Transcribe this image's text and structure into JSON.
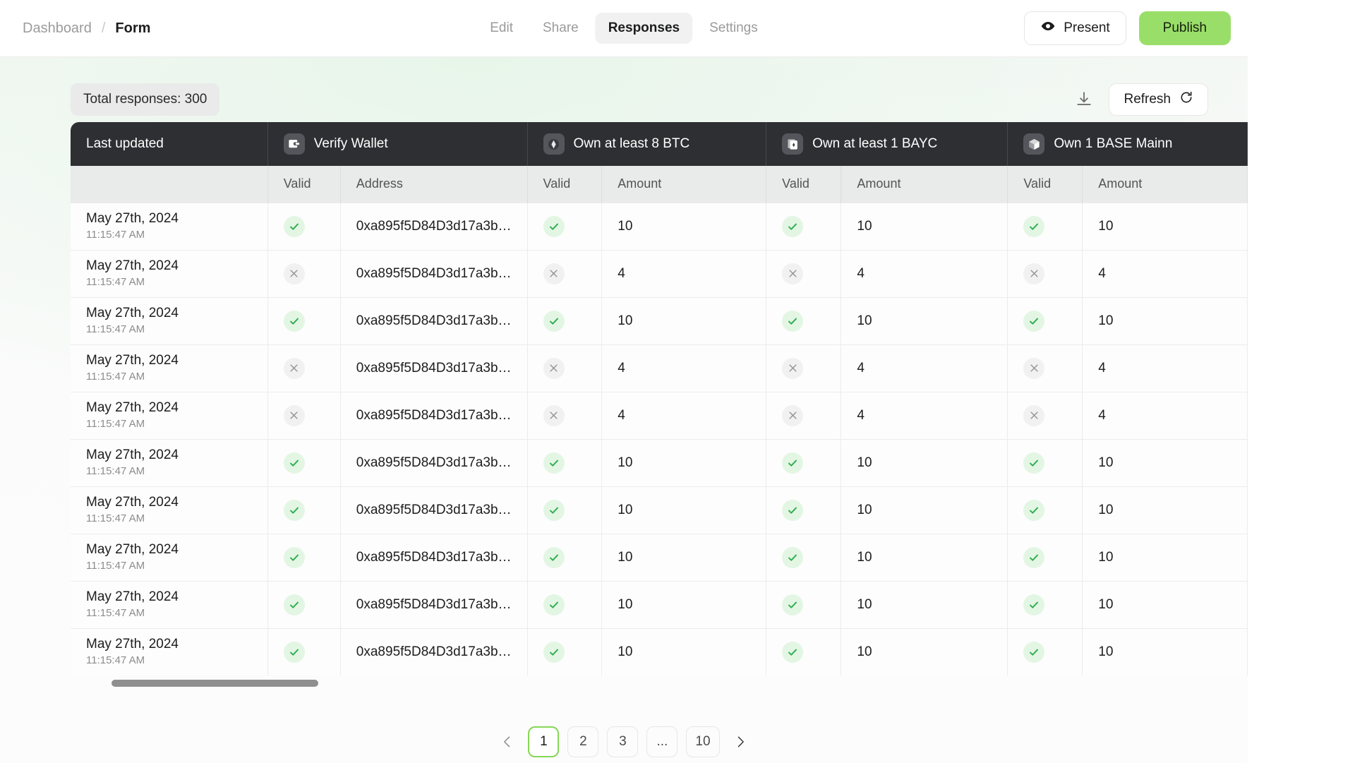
{
  "header": {
    "breadcrumb": {
      "root": "Dashboard",
      "separator": "/",
      "current": "Form"
    },
    "tabs": [
      {
        "label": "Edit",
        "active": false
      },
      {
        "label": "Share",
        "active": false
      },
      {
        "label": "Responses",
        "active": true
      },
      {
        "label": "Settings",
        "active": false
      }
    ],
    "present_label": "Present",
    "present_icon": "eye-icon",
    "publish_label": "Publish",
    "publish_color": "#9ade6a"
  },
  "toolbar": {
    "total_responses": "Total responses: 300",
    "download_icon": "download-icon",
    "refresh_label": "Refresh",
    "refresh_icon": "refresh-icon"
  },
  "table": {
    "groups": [
      {
        "label": "Last updated",
        "icon": null,
        "subcolumns": []
      },
      {
        "label": "Verify Wallet",
        "icon": "wallet-icon",
        "subcolumns": [
          "Valid",
          "Address"
        ]
      },
      {
        "label": "Own at least 8 BTC",
        "icon": "bitcoin-icon",
        "subcolumns": [
          "Valid",
          "Amount"
        ]
      },
      {
        "label": "Own at least 1 BAYC",
        "icon": "nft-icon",
        "subcolumns": [
          "Valid",
          "Amount"
        ]
      },
      {
        "label": "Own 1 BASE Mainn",
        "icon": "cube-icon",
        "subcolumns": [
          "Valid",
          "Amount"
        ]
      }
    ],
    "rows": [
      {
        "date": "May 27th, 2024",
        "time": "11:15:47 AM",
        "wallet_valid": true,
        "address": "0xa895f5D84D3d17a3b…",
        "btc_valid": true,
        "btc_amount": "10",
        "bayc_valid": true,
        "bayc_amount": "10",
        "base_valid": true,
        "base_amount": "10"
      },
      {
        "date": "May 27th, 2024",
        "time": "11:15:47 AM",
        "wallet_valid": false,
        "address": "0xa895f5D84D3d17a3b…",
        "btc_valid": false,
        "btc_amount": "4",
        "bayc_valid": false,
        "bayc_amount": "4",
        "base_valid": false,
        "base_amount": "4"
      },
      {
        "date": "May 27th, 2024",
        "time": "11:15:47 AM",
        "wallet_valid": true,
        "address": "0xa895f5D84D3d17a3b…",
        "btc_valid": true,
        "btc_amount": "10",
        "bayc_valid": true,
        "bayc_amount": "10",
        "base_valid": true,
        "base_amount": "10"
      },
      {
        "date": "May 27th, 2024",
        "time": "11:15:47 AM",
        "wallet_valid": false,
        "address": "0xa895f5D84D3d17a3b…",
        "btc_valid": false,
        "btc_amount": "4",
        "bayc_valid": false,
        "bayc_amount": "4",
        "base_valid": false,
        "base_amount": "4"
      },
      {
        "date": "May 27th, 2024",
        "time": "11:15:47 AM",
        "wallet_valid": false,
        "address": "0xa895f5D84D3d17a3b…",
        "btc_valid": false,
        "btc_amount": "4",
        "bayc_valid": false,
        "bayc_amount": "4",
        "base_valid": false,
        "base_amount": "4"
      },
      {
        "date": "May 27th, 2024",
        "time": "11:15:47 AM",
        "wallet_valid": true,
        "address": "0xa895f5D84D3d17a3b…",
        "btc_valid": true,
        "btc_amount": "10",
        "bayc_valid": true,
        "bayc_amount": "10",
        "base_valid": true,
        "base_amount": "10"
      },
      {
        "date": "May 27th, 2024",
        "time": "11:15:47 AM",
        "wallet_valid": true,
        "address": "0xa895f5D84D3d17a3b…",
        "btc_valid": true,
        "btc_amount": "10",
        "bayc_valid": true,
        "bayc_amount": "10",
        "base_valid": true,
        "base_amount": "10"
      },
      {
        "date": "May 27th, 2024",
        "time": "11:15:47 AM",
        "wallet_valid": true,
        "address": "0xa895f5D84D3d17a3b…",
        "btc_valid": true,
        "btc_amount": "10",
        "bayc_valid": true,
        "bayc_amount": "10",
        "base_valid": true,
        "base_amount": "10"
      },
      {
        "date": "May 27th, 2024",
        "time": "11:15:47 AM",
        "wallet_valid": true,
        "address": "0xa895f5D84D3d17a3b…",
        "btc_valid": true,
        "btc_amount": "10",
        "bayc_valid": true,
        "bayc_amount": "10",
        "base_valid": true,
        "base_amount": "10"
      },
      {
        "date": "May 27th, 2024",
        "time": "11:15:47 AM",
        "wallet_valid": true,
        "address": "0xa895f5D84D3d17a3b…",
        "btc_valid": true,
        "btc_amount": "10",
        "bayc_valid": true,
        "bayc_amount": "10",
        "base_valid": true,
        "base_amount": "10"
      }
    ],
    "valid_icon": "check-icon",
    "invalid_icon": "cross-icon"
  },
  "pagination": {
    "prev_icon": "chevron-left-icon",
    "next_icon": "chevron-right-icon",
    "pages": [
      {
        "label": "1",
        "active": true
      },
      {
        "label": "2",
        "active": false
      },
      {
        "label": "3",
        "active": false
      },
      {
        "label": "...",
        "active": false
      },
      {
        "label": "10",
        "active": false
      }
    ],
    "active_color": "#86d755"
  }
}
